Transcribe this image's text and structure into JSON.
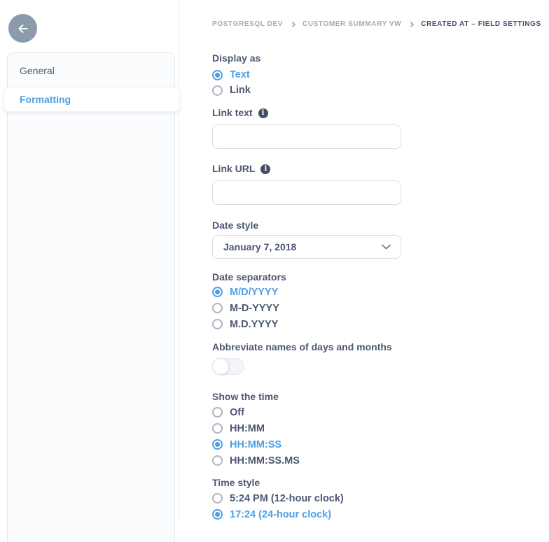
{
  "colors": {
    "brand_blue": "#509EE3",
    "text_dark": "#4C5773",
    "text_muted": "#A3AAB9",
    "back_button_bg": "#8C9BAB"
  },
  "icons": {
    "info_glyph": "i"
  },
  "header": {
    "breadcrumb": [
      {
        "label": "POSTGRESQL DEV",
        "active": false
      },
      {
        "label": "CUSTOMER SUMMARY VW",
        "active": false
      },
      {
        "label": "CREATED AT – FIELD SETTINGS",
        "active": true
      }
    ]
  },
  "sidebar": {
    "items": [
      {
        "label": "General",
        "active": false
      },
      {
        "label": "Formatting",
        "active": true
      }
    ]
  },
  "main": {
    "display_as": {
      "label": "Display as",
      "options": [
        {
          "label": "Text",
          "selected": true
        },
        {
          "label": "Link",
          "selected": false
        }
      ]
    },
    "link_text": {
      "label": "Link text",
      "value": ""
    },
    "link_url": {
      "label": "Link URL",
      "value": ""
    },
    "date_style": {
      "label": "Date style",
      "selected_value": "January 7, 2018"
    },
    "date_separators": {
      "label": "Date separators",
      "options": [
        {
          "label": "M/D/YYYY",
          "selected": true
        },
        {
          "label": "M-D-YYYY",
          "selected": false
        },
        {
          "label": "M.D.YYYY",
          "selected": false
        }
      ]
    },
    "abbreviate": {
      "label": "Abbreviate names of days and months",
      "enabled": false
    },
    "show_time": {
      "label": "Show the time",
      "options": [
        {
          "label": "Off",
          "selected": false
        },
        {
          "label": "HH:MM",
          "selected": false
        },
        {
          "label": "HH:MM:SS",
          "selected": true
        },
        {
          "label": "HH:MM:SS.MS",
          "selected": false
        }
      ]
    },
    "time_style": {
      "label": "Time style",
      "options": [
        {
          "label": "5:24 PM (12-hour clock)",
          "selected": false
        },
        {
          "label": "17:24 (24-hour clock)",
          "selected": true
        }
      ]
    }
  }
}
